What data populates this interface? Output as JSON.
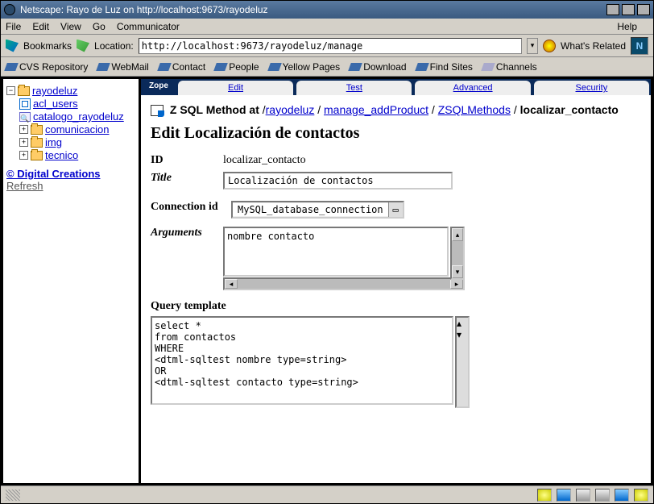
{
  "title": "Netscape: Rayo de Luz on http://localhost:9673/rayodeluz",
  "menu": {
    "file": "File",
    "edit": "Edit",
    "view": "View",
    "go": "Go",
    "comm": "Communicator",
    "help": "Help"
  },
  "toolbar": {
    "bookmarks": "Bookmarks",
    "location_label": "Location:",
    "location_value": "http://localhost:9673/rayodeluz/manage",
    "whats_related": "What's Related"
  },
  "quicklinks": [
    "CVS Repository",
    "WebMail",
    "Contact",
    "People",
    "Yellow Pages",
    "Download",
    "Find Sites",
    "Channels"
  ],
  "tree": {
    "root": "rayodeluz",
    "items": [
      {
        "type": "db",
        "label": "acl_users"
      },
      {
        "type": "cat",
        "label": "catalogo_rayodeluz"
      },
      {
        "type": "folder",
        "exp": true,
        "label": "comunicacion"
      },
      {
        "type": "folder",
        "exp": true,
        "label": "img"
      },
      {
        "type": "folder",
        "exp": true,
        "label": "tecnico"
      }
    ],
    "credit": "© Digital Creations",
    "refresh": "Refresh"
  },
  "tabs": {
    "zope": "Zope",
    "edit": "Edit",
    "test": "Test",
    "advanced": "Advanced",
    "security": "Security"
  },
  "breadcrumb": {
    "prefix": "Z SQL Method at ",
    "p1": "rayodeluz",
    "p2": "manage_addProduct",
    "p3": "ZSQLMethods",
    "last": "localizar_contacto"
  },
  "heading": "Edit Localización de contactos",
  "form": {
    "id_label": "ID",
    "id_value": "localizar_contacto",
    "title_label": "Title",
    "title_value": "Localización de contactos",
    "conn_label": "Connection id",
    "conn_value": "MySQL_database_connection",
    "args_label": "Arguments",
    "args_value": "nombre contacto",
    "qt_label": "Query template",
    "qt_value": "select *\nfrom contactos\nWHERE\n<dtml-sqltest nombre type=string>\nOR\n<dtml-sqltest contacto type=string>"
  }
}
